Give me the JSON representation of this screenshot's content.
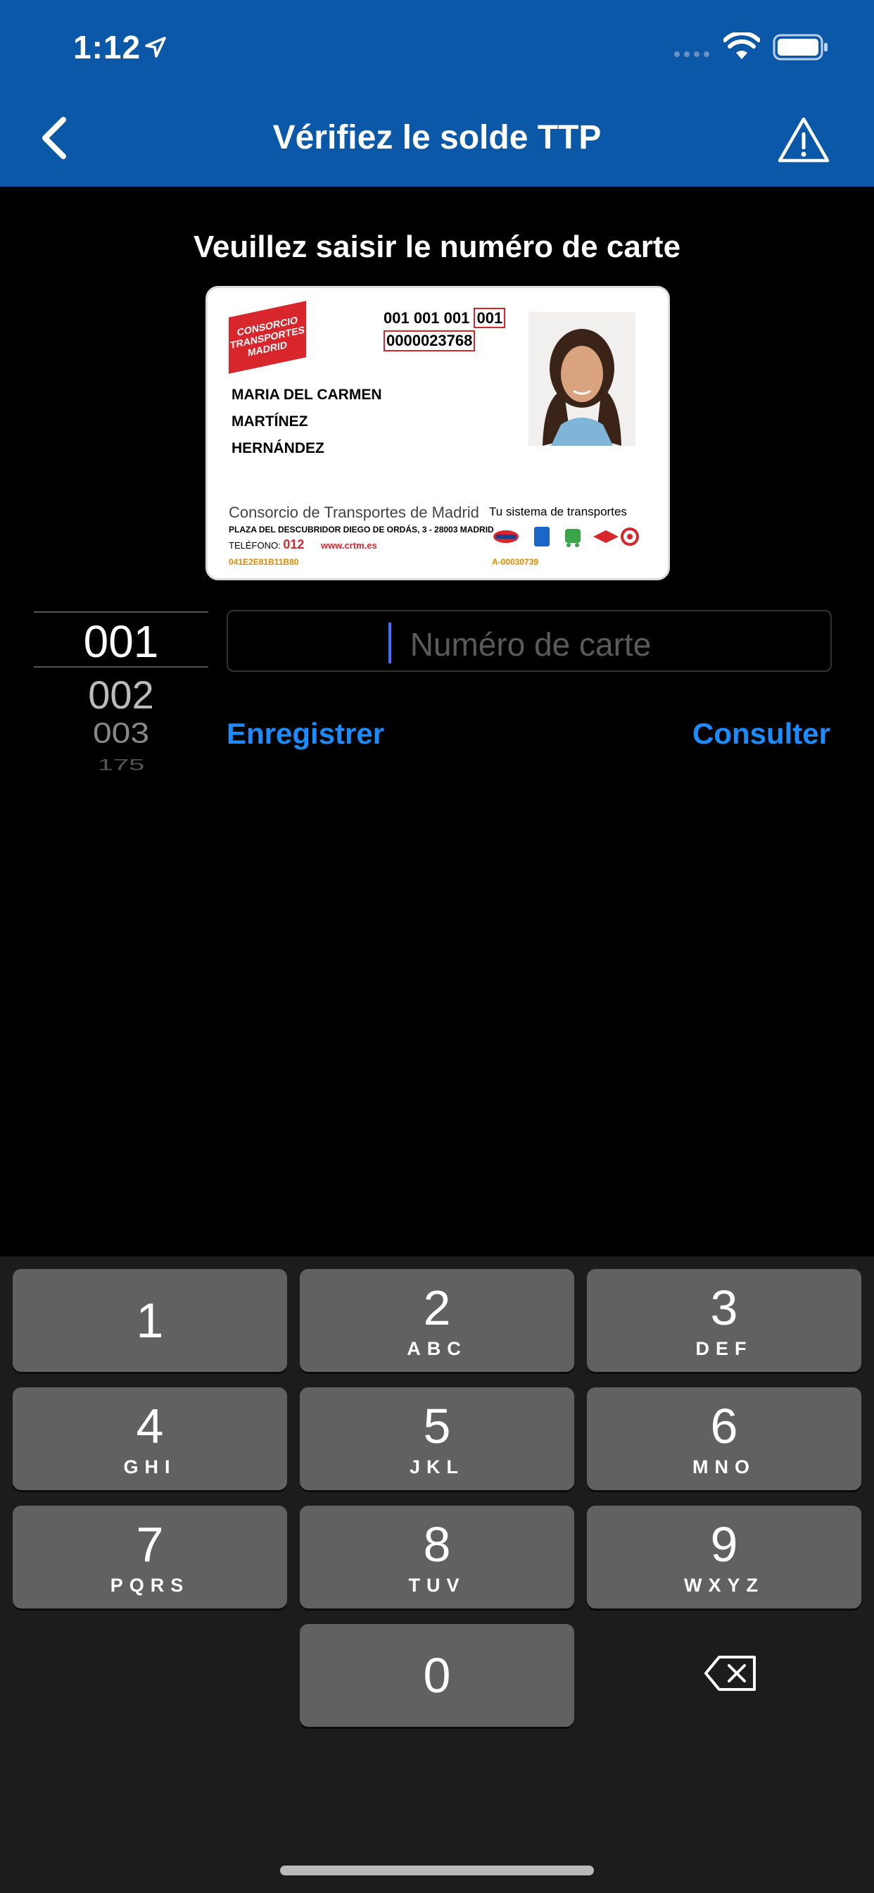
{
  "status_bar": {
    "time": "1:12"
  },
  "nav": {
    "title": "Vérifiez le solde TTP",
    "back_icon": "chevron-left-icon",
    "warning_icon": "warning-triangle-icon"
  },
  "main": {
    "instruction": "Veuillez saisir le numéro de carte",
    "card_image": {
      "logo_text": "CONSORCIO TRANSPORTES MADRID",
      "number_line1": "001 001 001",
      "number_line1_highlight": "001",
      "number_line2": "0000023768",
      "holder_name": [
        "MARIA DEL CARMEN",
        "MARTÍNEZ",
        "HERNÁNDEZ"
      ],
      "organization": "Consorcio de Transportes de Madrid",
      "address": "PLAZA DEL DESCUBRIDOR DIEGO DE ORDÁS, 3 - 28003 MADRID",
      "phone_label": "TELÉFONO:",
      "phone": "012",
      "website": "www.crtm.es",
      "serial": "041E2E81B11B80",
      "tagline": "Tu sistema de transportes",
      "code": "A-00030739"
    },
    "picker": {
      "items": [
        "001",
        "002",
        "003",
        "175"
      ],
      "selected": "001"
    },
    "card_number_input": {
      "value": "",
      "placeholder": "Numéro de carte"
    },
    "save_label": "Enregistrer",
    "consult_label": "Consulter"
  },
  "keyboard": {
    "keys": [
      {
        "num": "1",
        "letters": ""
      },
      {
        "num": "2",
        "letters": "ABC"
      },
      {
        "num": "3",
        "letters": "DEF"
      },
      {
        "num": "4",
        "letters": "GHI"
      },
      {
        "num": "5",
        "letters": "JKL"
      },
      {
        "num": "6",
        "letters": "MNO"
      },
      {
        "num": "7",
        "letters": "PQRS"
      },
      {
        "num": "8",
        "letters": "TUV"
      },
      {
        "num": "9",
        "letters": "WXYZ"
      },
      {
        "num": "0",
        "letters": ""
      }
    ],
    "delete_icon": "backspace-icon"
  },
  "colors": {
    "nav_bg": "#0b58a8",
    "link": "#1a8cff",
    "caret": "#4a6cff",
    "key_bg": "#616161",
    "keyboard_bg": "#1c1c1c"
  }
}
